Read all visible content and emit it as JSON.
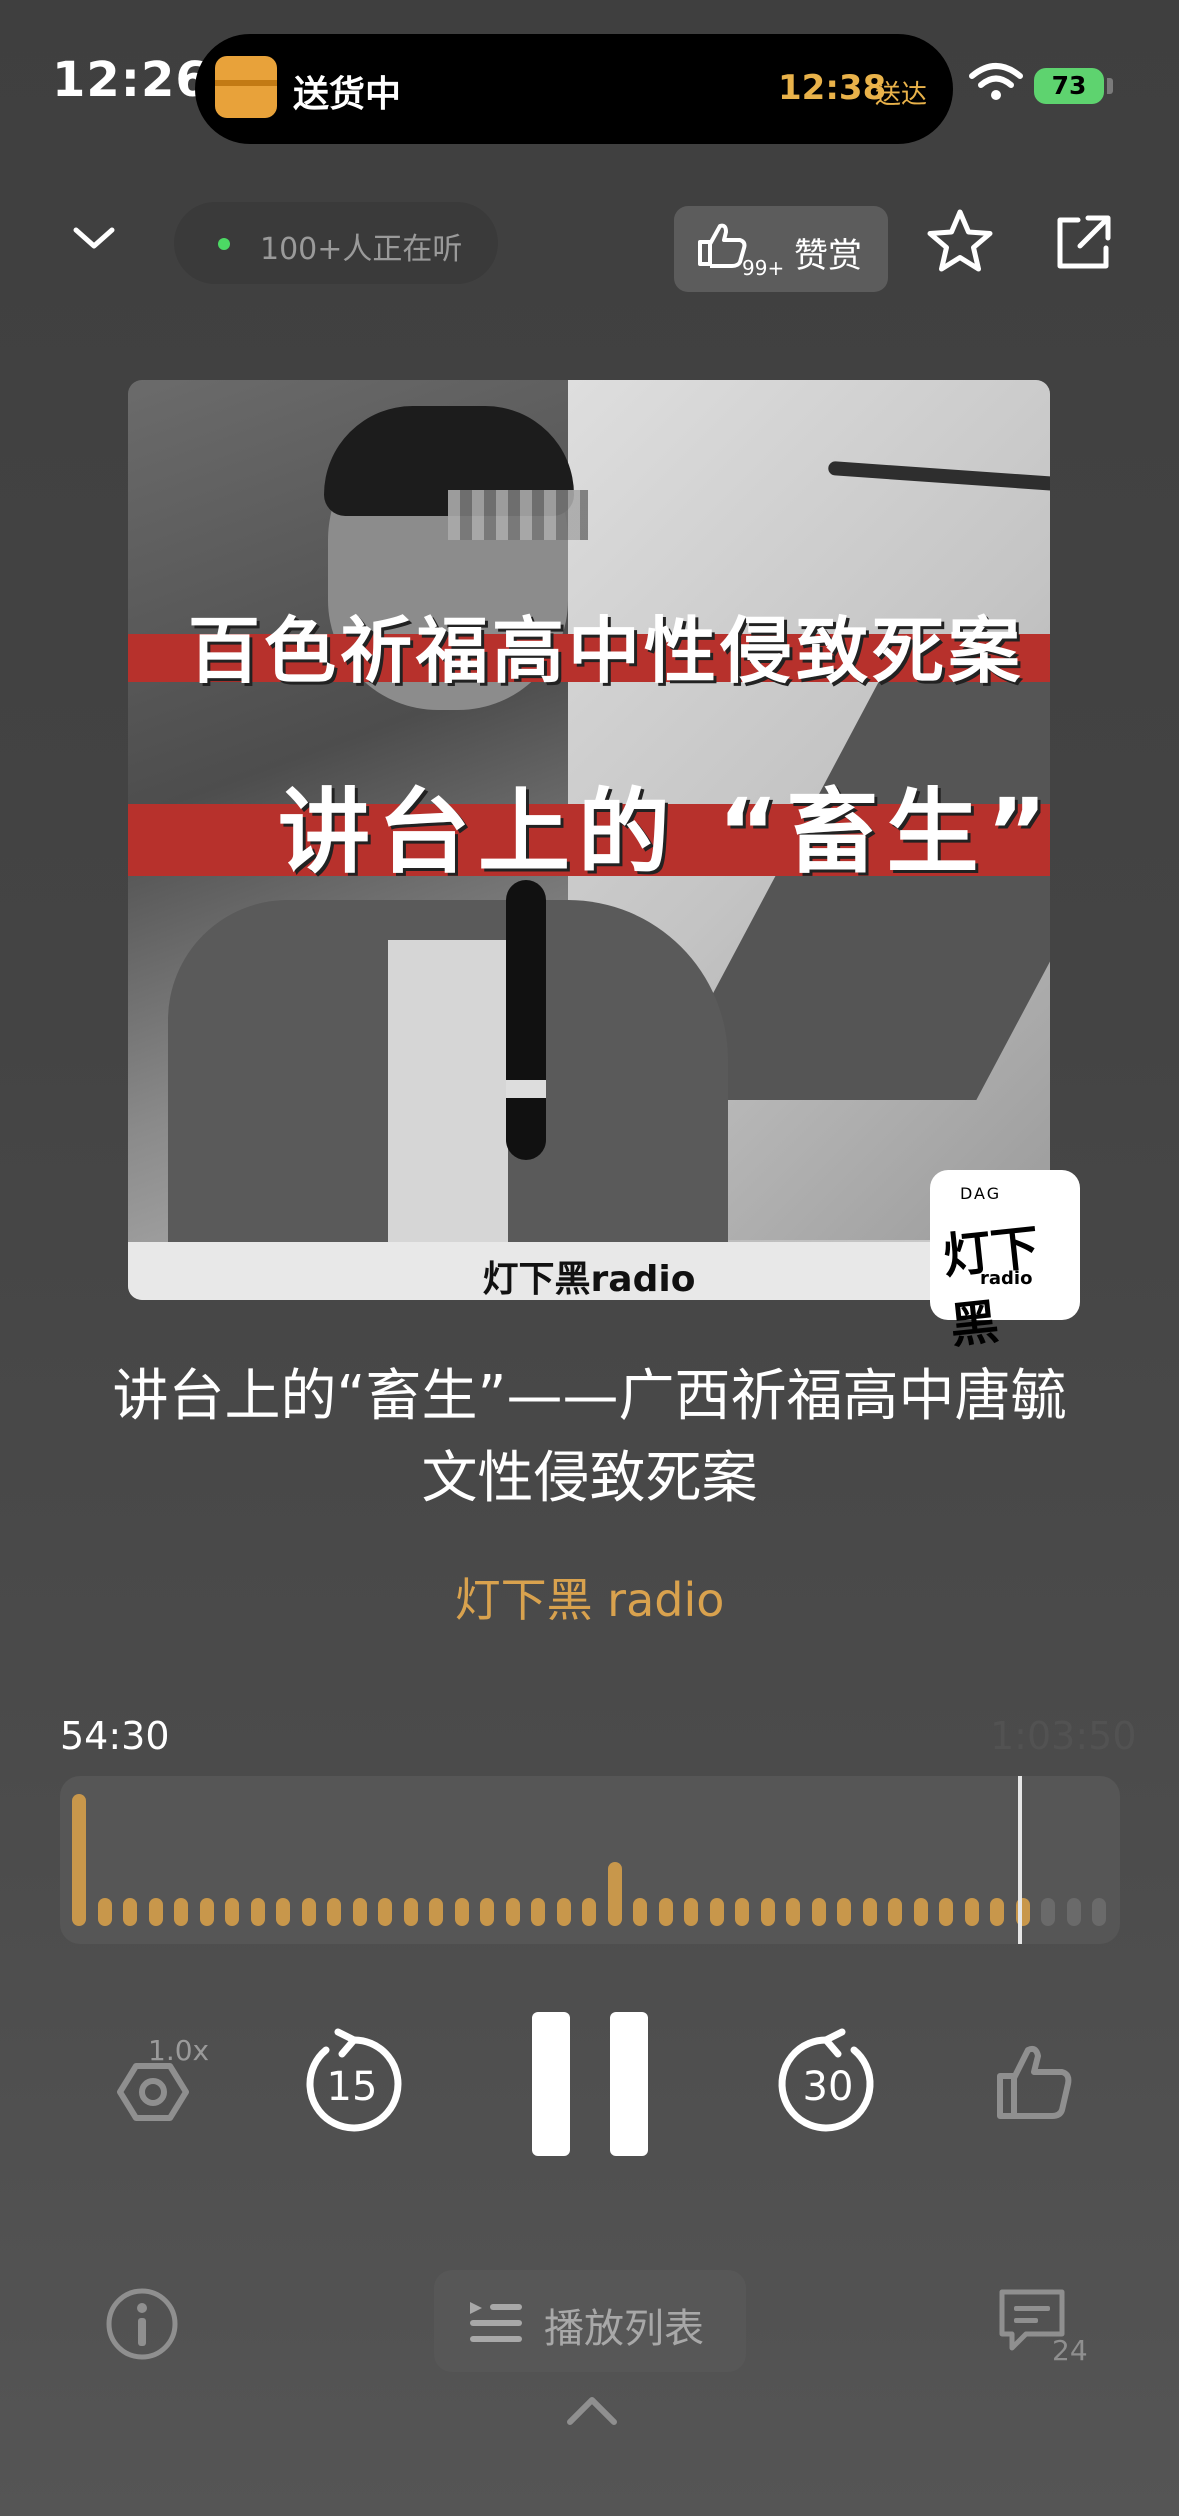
{
  "status_bar": {
    "time": "12:26",
    "live_activity_label": "送货中",
    "live_activity_eta": "12:38",
    "live_activity_eta_suffix": "送达",
    "battery": "73"
  },
  "top_bar": {
    "listeners": "100+人正在听",
    "reward_count": "99+",
    "reward_label": "赞赏"
  },
  "cover": {
    "headline_1": "百色祈福高中性侵致死案",
    "headline_2": "讲台上的 “畜生”",
    "footer": "灯下黑radio",
    "logo_text": "灯下黑",
    "logo_sub": "radio",
    "logo_top": "DAG"
  },
  "episode": {
    "title": "讲台上的“畜生”——广西祈福高中唐毓文性侵致死案",
    "author": "灯下黑 radio"
  },
  "player": {
    "current_time": "54:30",
    "total_time": "1:03:50",
    "progress": 0.905,
    "speed": "1.0x",
    "rewind_seconds": "15",
    "forward_seconds": "30",
    "comments_count": "24",
    "playlist_label": "播放列表"
  },
  "colors": {
    "accent": "#d9a24e",
    "played_bar": "#c8974b",
    "unplayed_bar": "#6a6a6a",
    "battery": "#5ed36f"
  },
  "icons": [
    "collapse-chevron-icon",
    "thumbs-up-icon",
    "star-icon",
    "share-icon",
    "speed-gear-icon",
    "rewind-15-icon",
    "pause-icon",
    "forward-30-icon",
    "like-icon",
    "info-icon",
    "playlist-icon",
    "chevron-up-icon",
    "comments-icon",
    "wifi-icon",
    "package-icon"
  ]
}
